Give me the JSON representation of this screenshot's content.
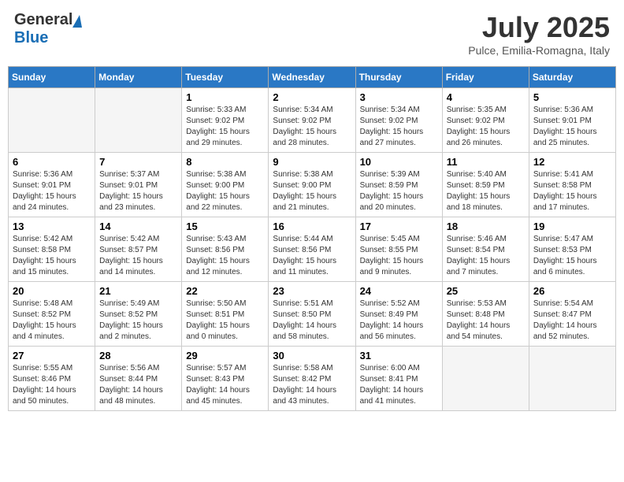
{
  "header": {
    "logo_general": "General",
    "logo_blue": "Blue",
    "title": "July 2025",
    "subtitle": "Pulce, Emilia-Romagna, Italy"
  },
  "days_of_week": [
    "Sunday",
    "Monday",
    "Tuesday",
    "Wednesday",
    "Thursday",
    "Friday",
    "Saturday"
  ],
  "weeks": [
    [
      {
        "day": "",
        "info": ""
      },
      {
        "day": "",
        "info": ""
      },
      {
        "day": "1",
        "info": "Sunrise: 5:33 AM\nSunset: 9:02 PM\nDaylight: 15 hours\nand 29 minutes."
      },
      {
        "day": "2",
        "info": "Sunrise: 5:34 AM\nSunset: 9:02 PM\nDaylight: 15 hours\nand 28 minutes."
      },
      {
        "day": "3",
        "info": "Sunrise: 5:34 AM\nSunset: 9:02 PM\nDaylight: 15 hours\nand 27 minutes."
      },
      {
        "day": "4",
        "info": "Sunrise: 5:35 AM\nSunset: 9:02 PM\nDaylight: 15 hours\nand 26 minutes."
      },
      {
        "day": "5",
        "info": "Sunrise: 5:36 AM\nSunset: 9:01 PM\nDaylight: 15 hours\nand 25 minutes."
      }
    ],
    [
      {
        "day": "6",
        "info": "Sunrise: 5:36 AM\nSunset: 9:01 PM\nDaylight: 15 hours\nand 24 minutes."
      },
      {
        "day": "7",
        "info": "Sunrise: 5:37 AM\nSunset: 9:01 PM\nDaylight: 15 hours\nand 23 minutes."
      },
      {
        "day": "8",
        "info": "Sunrise: 5:38 AM\nSunset: 9:00 PM\nDaylight: 15 hours\nand 22 minutes."
      },
      {
        "day": "9",
        "info": "Sunrise: 5:38 AM\nSunset: 9:00 PM\nDaylight: 15 hours\nand 21 minutes."
      },
      {
        "day": "10",
        "info": "Sunrise: 5:39 AM\nSunset: 8:59 PM\nDaylight: 15 hours\nand 20 minutes."
      },
      {
        "day": "11",
        "info": "Sunrise: 5:40 AM\nSunset: 8:59 PM\nDaylight: 15 hours\nand 18 minutes."
      },
      {
        "day": "12",
        "info": "Sunrise: 5:41 AM\nSunset: 8:58 PM\nDaylight: 15 hours\nand 17 minutes."
      }
    ],
    [
      {
        "day": "13",
        "info": "Sunrise: 5:42 AM\nSunset: 8:58 PM\nDaylight: 15 hours\nand 15 minutes."
      },
      {
        "day": "14",
        "info": "Sunrise: 5:42 AM\nSunset: 8:57 PM\nDaylight: 15 hours\nand 14 minutes."
      },
      {
        "day": "15",
        "info": "Sunrise: 5:43 AM\nSunset: 8:56 PM\nDaylight: 15 hours\nand 12 minutes."
      },
      {
        "day": "16",
        "info": "Sunrise: 5:44 AM\nSunset: 8:56 PM\nDaylight: 15 hours\nand 11 minutes."
      },
      {
        "day": "17",
        "info": "Sunrise: 5:45 AM\nSunset: 8:55 PM\nDaylight: 15 hours\nand 9 minutes."
      },
      {
        "day": "18",
        "info": "Sunrise: 5:46 AM\nSunset: 8:54 PM\nDaylight: 15 hours\nand 7 minutes."
      },
      {
        "day": "19",
        "info": "Sunrise: 5:47 AM\nSunset: 8:53 PM\nDaylight: 15 hours\nand 6 minutes."
      }
    ],
    [
      {
        "day": "20",
        "info": "Sunrise: 5:48 AM\nSunset: 8:52 PM\nDaylight: 15 hours\nand 4 minutes."
      },
      {
        "day": "21",
        "info": "Sunrise: 5:49 AM\nSunset: 8:52 PM\nDaylight: 15 hours\nand 2 minutes."
      },
      {
        "day": "22",
        "info": "Sunrise: 5:50 AM\nSunset: 8:51 PM\nDaylight: 15 hours\nand 0 minutes."
      },
      {
        "day": "23",
        "info": "Sunrise: 5:51 AM\nSunset: 8:50 PM\nDaylight: 14 hours\nand 58 minutes."
      },
      {
        "day": "24",
        "info": "Sunrise: 5:52 AM\nSunset: 8:49 PM\nDaylight: 14 hours\nand 56 minutes."
      },
      {
        "day": "25",
        "info": "Sunrise: 5:53 AM\nSunset: 8:48 PM\nDaylight: 14 hours\nand 54 minutes."
      },
      {
        "day": "26",
        "info": "Sunrise: 5:54 AM\nSunset: 8:47 PM\nDaylight: 14 hours\nand 52 minutes."
      }
    ],
    [
      {
        "day": "27",
        "info": "Sunrise: 5:55 AM\nSunset: 8:46 PM\nDaylight: 14 hours\nand 50 minutes."
      },
      {
        "day": "28",
        "info": "Sunrise: 5:56 AM\nSunset: 8:44 PM\nDaylight: 14 hours\nand 48 minutes."
      },
      {
        "day": "29",
        "info": "Sunrise: 5:57 AM\nSunset: 8:43 PM\nDaylight: 14 hours\nand 45 minutes."
      },
      {
        "day": "30",
        "info": "Sunrise: 5:58 AM\nSunset: 8:42 PM\nDaylight: 14 hours\nand 43 minutes."
      },
      {
        "day": "31",
        "info": "Sunrise: 6:00 AM\nSunset: 8:41 PM\nDaylight: 14 hours\nand 41 minutes."
      },
      {
        "day": "",
        "info": ""
      },
      {
        "day": "",
        "info": ""
      }
    ]
  ]
}
